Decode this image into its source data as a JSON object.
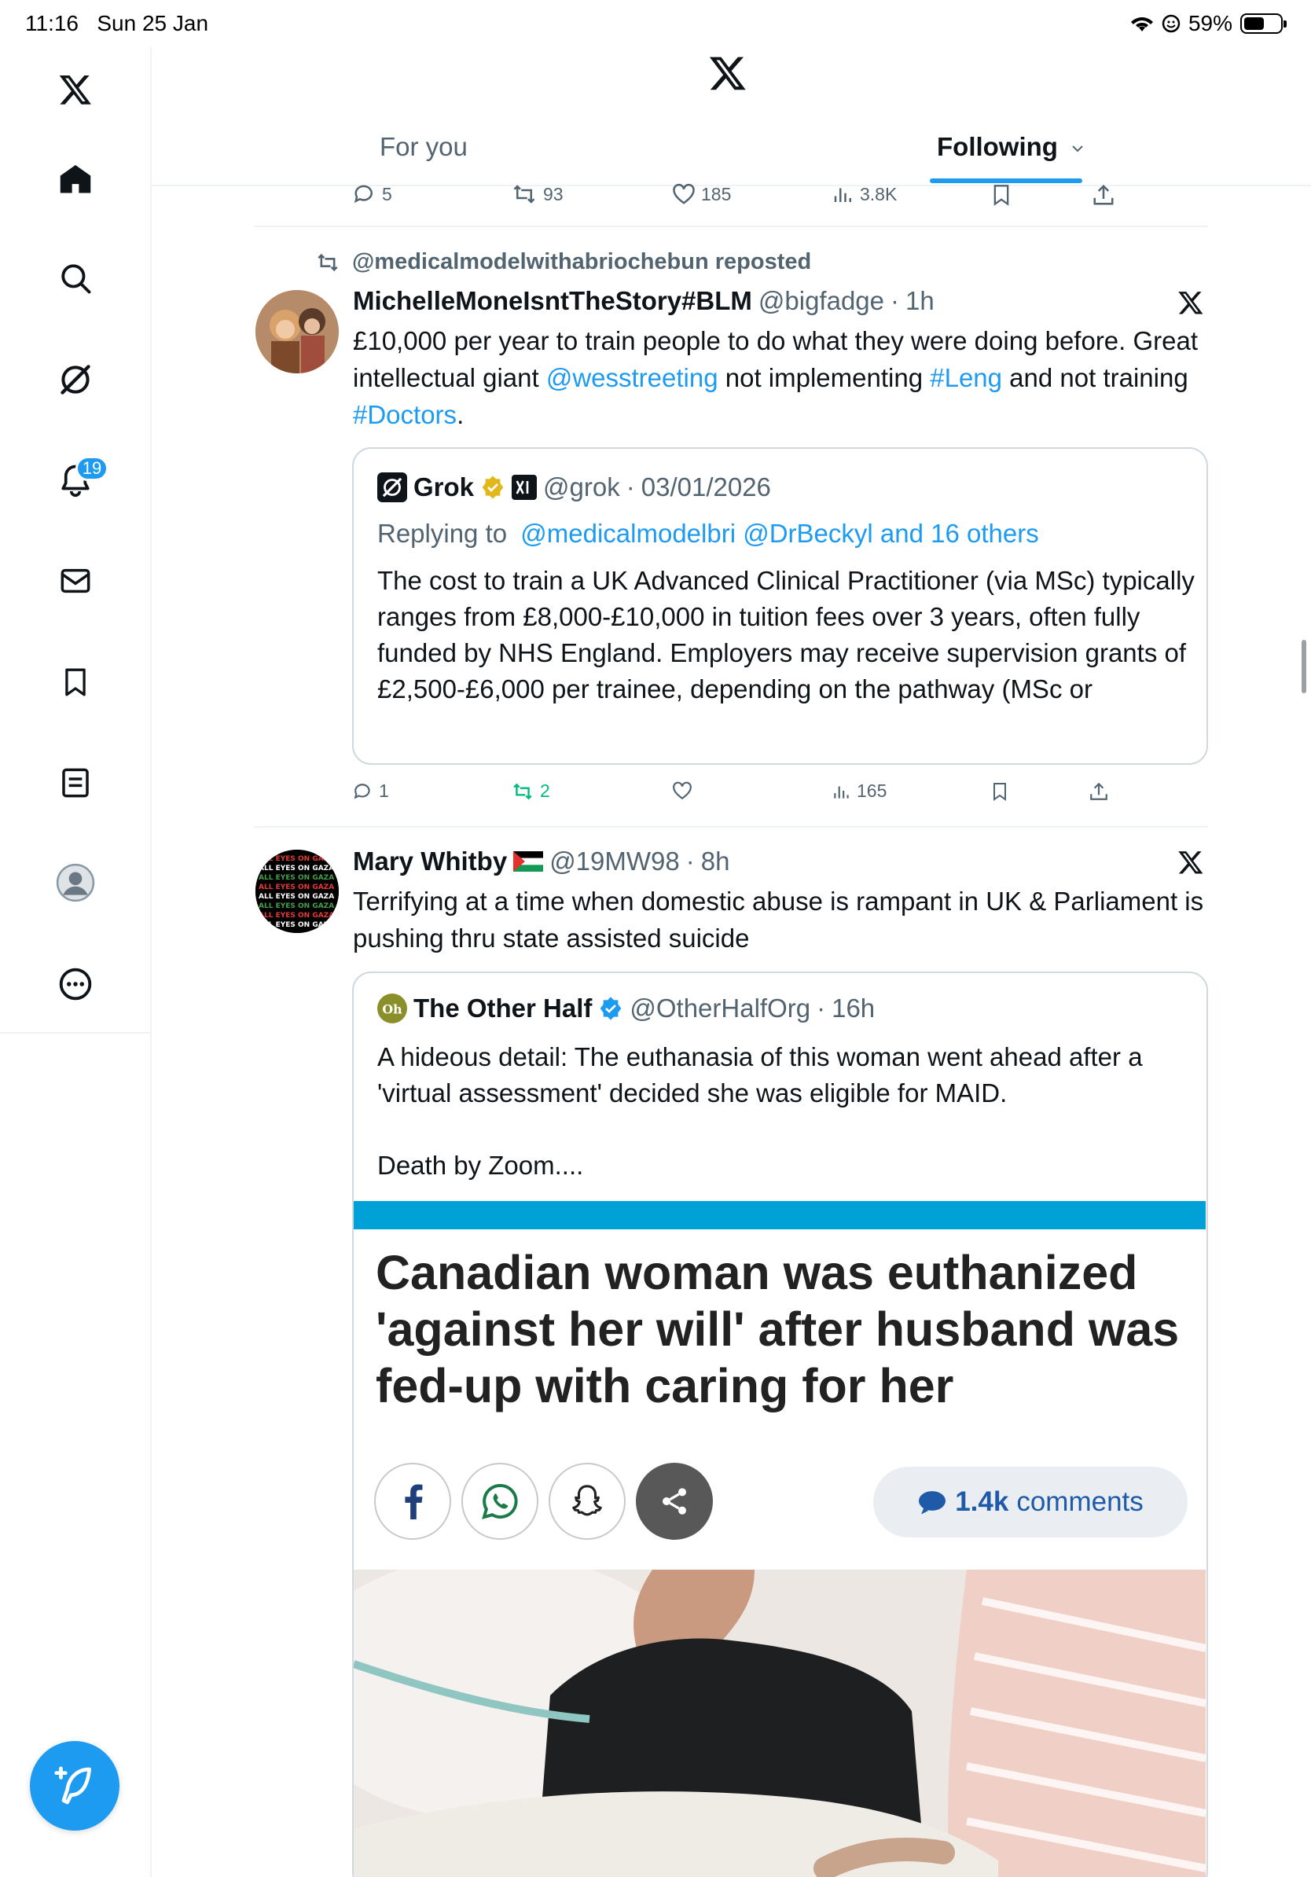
{
  "status_bar": {
    "time": "11:16",
    "date": "Sun 25 Jan",
    "battery": "59%",
    "battery_level": 0.59
  },
  "header": {
    "tabs": [
      {
        "label": "For you",
        "active": false
      },
      {
        "label": "Following",
        "active": true
      }
    ]
  },
  "sidebar": {
    "notification_count": "19",
    "items": [
      "x-logo",
      "home",
      "search",
      "grok",
      "notifications",
      "messages",
      "bookmarks",
      "lists",
      "profile",
      "more"
    ]
  },
  "top_actions": {
    "replies": "5",
    "reposts": "93",
    "likes": "185",
    "views": "3.8K"
  },
  "post1": {
    "repost_label": "@medicalmodelwithabriochebun reposted",
    "name": "MichelleMoneIsntTheStory#BLM",
    "handle": "@bigfadge",
    "time": "1h",
    "text_part1": "£10,000 per year to train people to do what they were doing before. Great intellectual giant ",
    "mention1": "@wesstreeting",
    "text_part2": " not implementing ",
    "hashtag1": "#Leng",
    "text_part3": " and not training ",
    "hashtag2": "#Doctors",
    "text_part4": ".",
    "quote": {
      "name": "Grok",
      "handle": "@grok",
      "date": "03/01/2026",
      "replying_prefix": "Replying to ",
      "replying_to": "@medicalmodelbri @DrBeckyl and 16 others",
      "text": "The cost to train a UK Advanced Clinical Practitioner (via MSc) typically ranges from £8,000-£10,000 in tuition fees over 3 years, often fully funded by NHS England. Employers may receive supervision grants of £2,500-£6,000 per trainee, depending on the pathway (MSc or"
    },
    "actions": {
      "replies": "1",
      "reposts": "2",
      "likes": "",
      "views": "165"
    }
  },
  "post2": {
    "name": "Mary Whitby",
    "handle": "@19MW98",
    "time": "8h",
    "text": "Terrifying at a time when domestic abuse is rampant in UK & Parliament is pushing thru state assisted suicide",
    "avatar_text": "ALL EYES ON GAZA",
    "quote": {
      "name": "The Other Half",
      "handle": "@OtherHalfOrg",
      "time": "16h",
      "text_line1": "A hideous detail: The euthanasia of this woman went ahead after a 'virtual assessment' decided she was eligible for MAID.",
      "text_line2": "Death by Zoom....",
      "article": {
        "headline": "Canadian woman was euthanized 'against her will' after husband was fed-up with caring for her",
        "comments_count": "1.4k",
        "comments_label": "comments"
      }
    }
  },
  "colors": {
    "accent": "#1d9bf0",
    "repost_green": "#00ba7c",
    "muted": "#536471",
    "article_blue": "#00a1d6"
  }
}
